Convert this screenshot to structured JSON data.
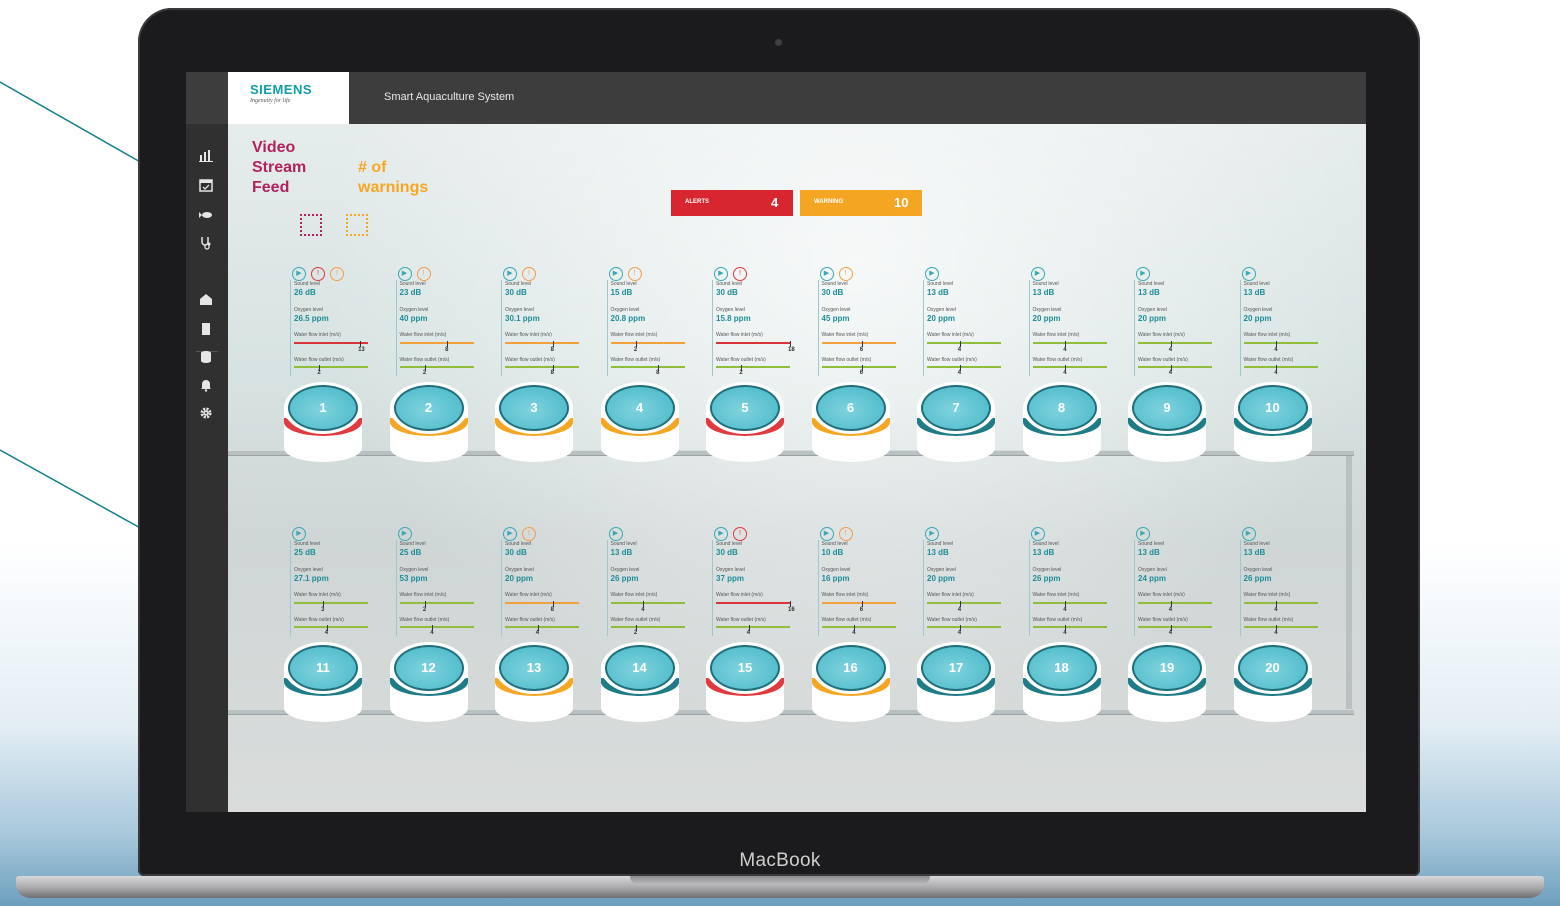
{
  "colors": {
    "alert": "#e0393e",
    "warning": "#f5a623",
    "normal": "#1e7c86",
    "accent": "#0f9ea8",
    "annotation_video": "#b0235c"
  },
  "laptop": {
    "label": "MacBook"
  },
  "app": {
    "logo": "SIEMENS",
    "logo_tagline": "Ingenuity for life",
    "title": "Smart Aquaculture System"
  },
  "sidebar": {
    "items": [
      {
        "icon": "chart-icon"
      },
      {
        "icon": "calendar-icon"
      },
      {
        "icon": "fish-icon"
      },
      {
        "icon": "stethoscope-icon"
      },
      {
        "icon": "building-icon"
      },
      {
        "icon": "server-icon"
      },
      {
        "icon": "database-icon"
      },
      {
        "icon": "bell-icon"
      },
      {
        "icon": "gear-icon"
      }
    ]
  },
  "annotations": {
    "video": "Video Stream Feed",
    "warnings": "# of warnings"
  },
  "counters": {
    "alerts_label": "ALERTS",
    "alerts_value": "4",
    "warnings_label": "WARNING",
    "warnings_value": "10"
  },
  "tanks": [
    {
      "num": "1",
      "status": "alert",
      "sound": "26 dB",
      "oxygen": "26.5 ppm",
      "inlet": "13",
      "outlet": "2",
      "icons": [
        "cam",
        "alert",
        "warn"
      ]
    },
    {
      "num": "2",
      "status": "warning",
      "sound": "23 dB",
      "oxygen": "40 ppm",
      "inlet": "8",
      "outlet": "2",
      "icons": [
        "cam",
        "warn"
      ]
    },
    {
      "num": "3",
      "status": "warning",
      "sound": "30 dB",
      "oxygen": "30.1 ppm",
      "inlet": "8",
      "outlet": "8",
      "icons": [
        "cam",
        "warn"
      ]
    },
    {
      "num": "4",
      "status": "warning",
      "sound": "15 dB",
      "oxygen": "20.8 ppm",
      "inlet": "2",
      "outlet": "8",
      "icons": [
        "cam",
        "warn"
      ]
    },
    {
      "num": "5",
      "status": "alert",
      "sound": "30 dB",
      "oxygen": "15.8 ppm",
      "inlet": "18",
      "outlet": "2",
      "icons": [
        "cam",
        "alert"
      ]
    },
    {
      "num": "6",
      "status": "warning",
      "sound": "30 dB",
      "oxygen": "45 ppm",
      "inlet": "6",
      "outlet": "6",
      "icons": [
        "cam",
        "warn"
      ]
    },
    {
      "num": "7",
      "status": "normal",
      "sound": "13 dB",
      "oxygen": "20 ppm",
      "inlet": "4",
      "outlet": "4",
      "icons": [
        "cam"
      ]
    },
    {
      "num": "8",
      "status": "normal",
      "sound": "13 dB",
      "oxygen": "20 ppm",
      "inlet": "4",
      "outlet": "4",
      "icons": [
        "cam"
      ]
    },
    {
      "num": "9",
      "status": "normal",
      "sound": "13 dB",
      "oxygen": "20 ppm",
      "inlet": "4",
      "outlet": "4",
      "icons": [
        "cam"
      ]
    },
    {
      "num": "10",
      "status": "normal",
      "sound": "13 dB",
      "oxygen": "20 ppm",
      "inlet": "4",
      "outlet": "4",
      "icons": [
        "cam"
      ]
    },
    {
      "num": "11",
      "status": "normal",
      "sound": "25 dB",
      "oxygen": "27.1 ppm",
      "inlet": "3",
      "outlet": "4",
      "icons": [
        "cam"
      ]
    },
    {
      "num": "12",
      "status": "normal",
      "sound": "25 dB",
      "oxygen": "53 ppm",
      "inlet": "2",
      "outlet": "4",
      "icons": [
        "cam"
      ]
    },
    {
      "num": "13",
      "status": "warning",
      "sound": "30 dB",
      "oxygen": "20 ppm",
      "inlet": "8",
      "outlet": "4",
      "icons": [
        "cam",
        "warn"
      ]
    },
    {
      "num": "14",
      "status": "normal",
      "sound": "13 dB",
      "oxygen": "26 ppm",
      "inlet": "4",
      "outlet": "2",
      "icons": [
        "cam"
      ]
    },
    {
      "num": "15",
      "status": "alert",
      "sound": "30 dB",
      "oxygen": "37 ppm",
      "inlet": "16",
      "outlet": "4",
      "icons": [
        "cam",
        "alert"
      ]
    },
    {
      "num": "16",
      "status": "warning",
      "sound": "10 dB",
      "oxygen": "16 ppm",
      "inlet": "6",
      "outlet": "4",
      "icons": [
        "cam",
        "warn"
      ]
    },
    {
      "num": "17",
      "status": "normal",
      "sound": "13 dB",
      "oxygen": "20 ppm",
      "inlet": "4",
      "outlet": "4",
      "icons": [
        "cam"
      ]
    },
    {
      "num": "18",
      "status": "normal",
      "sound": "13 dB",
      "oxygen": "26 ppm",
      "inlet": "4",
      "outlet": "4",
      "icons": [
        "cam"
      ]
    },
    {
      "num": "19",
      "status": "normal",
      "sound": "13 dB",
      "oxygen": "24 ppm",
      "inlet": "4",
      "outlet": "4",
      "icons": [
        "cam"
      ]
    },
    {
      "num": "20",
      "status": "normal",
      "sound": "13 dB",
      "oxygen": "26 ppm",
      "inlet": "4",
      "outlet": "4",
      "icons": [
        "cam"
      ]
    }
  ]
}
